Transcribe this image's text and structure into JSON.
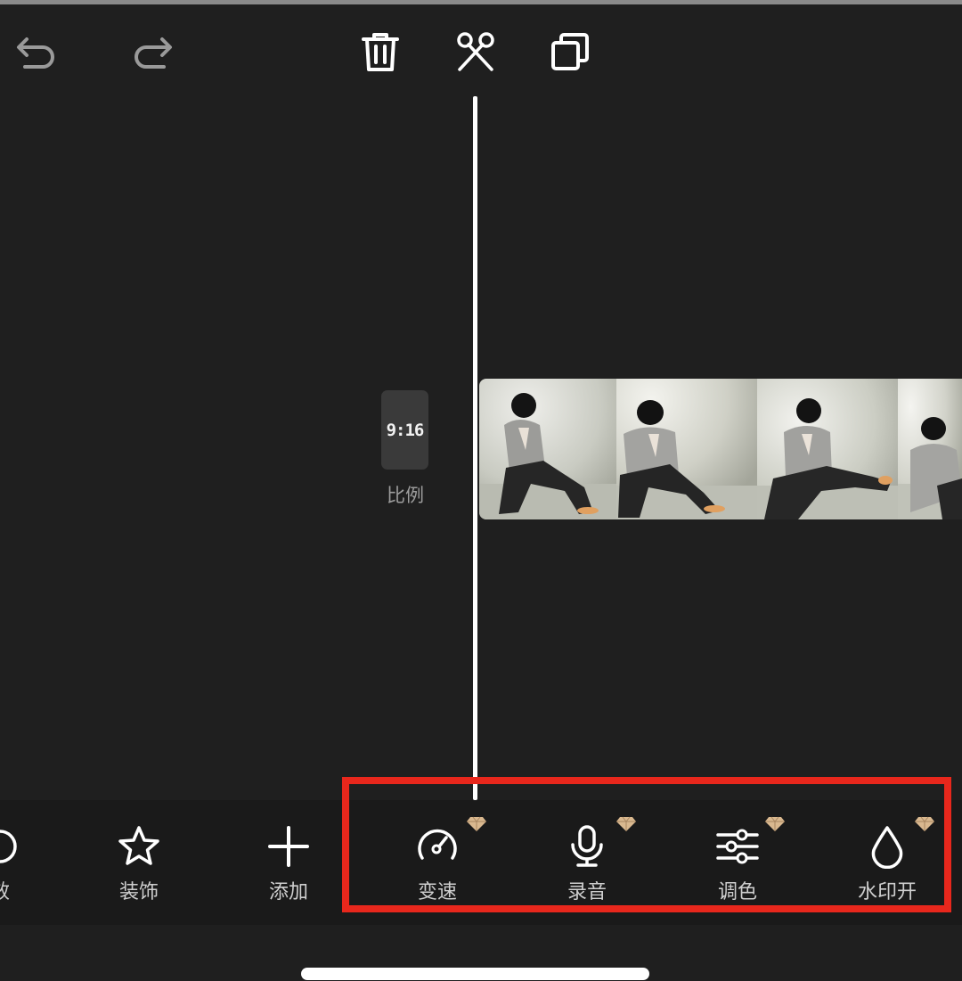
{
  "topbar": {
    "undo_icon": "undo-icon",
    "redo_icon": "redo-icon",
    "delete_icon": "trash-icon",
    "split_icon": "scissors-icon",
    "copy_icon": "copy-icon"
  },
  "timeline": {
    "ratio_value": "9:16",
    "ratio_label": "比例",
    "clip_frame_count": 4
  },
  "toolbar": {
    "items": [
      {
        "label": "效",
        "icon": "effect-icon",
        "premium": false
      },
      {
        "label": "装饰",
        "icon": "star-icon",
        "premium": false
      },
      {
        "label": "添加",
        "icon": "plus-icon",
        "premium": false
      },
      {
        "label": "变速",
        "icon": "speed-gauge-icon",
        "premium": true
      },
      {
        "label": "录音",
        "icon": "microphone-icon",
        "premium": true
      },
      {
        "label": "调色",
        "icon": "sliders-icon",
        "premium": true
      },
      {
        "label": "水印开",
        "icon": "water-drop-icon",
        "premium": true
      }
    ]
  },
  "colors": {
    "background": "#1f1f1f",
    "toolbar_background": "#1a1a1a",
    "highlight_border": "#e8271c",
    "premium_gem": "#d9b88f",
    "label_text": "#cfcfcf"
  }
}
